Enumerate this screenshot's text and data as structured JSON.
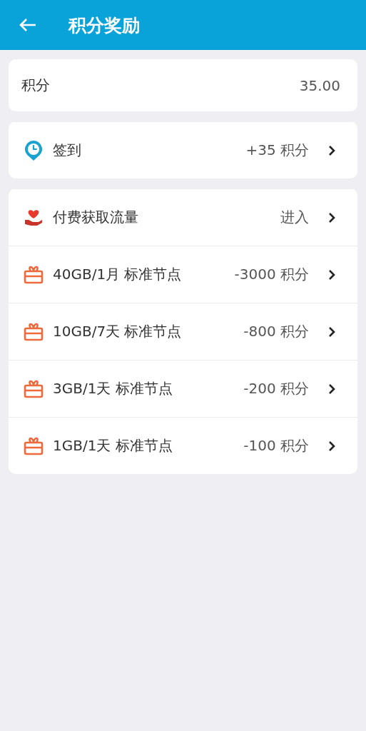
{
  "header": {
    "title": "积分奖励"
  },
  "balance": {
    "label": "积分",
    "value": "35.00"
  },
  "checkin": [
    {
      "kind": "checkin",
      "label": "签到",
      "value": "+35 积分"
    }
  ],
  "rewards": [
    {
      "kind": "paid",
      "label": "付费获取流量",
      "value": "进入"
    },
    {
      "kind": "gift",
      "label": "40GB/1月 标准节点",
      "value": "-3000 积分"
    },
    {
      "kind": "gift",
      "label": "10GB/7天 标准节点",
      "value": "-800 积分"
    },
    {
      "kind": "gift",
      "label": "3GB/1天 标准节点",
      "value": "-200 积分"
    },
    {
      "kind": "gift",
      "label": "1GB/1天 标准节点",
      "value": "-100 积分"
    }
  ]
}
